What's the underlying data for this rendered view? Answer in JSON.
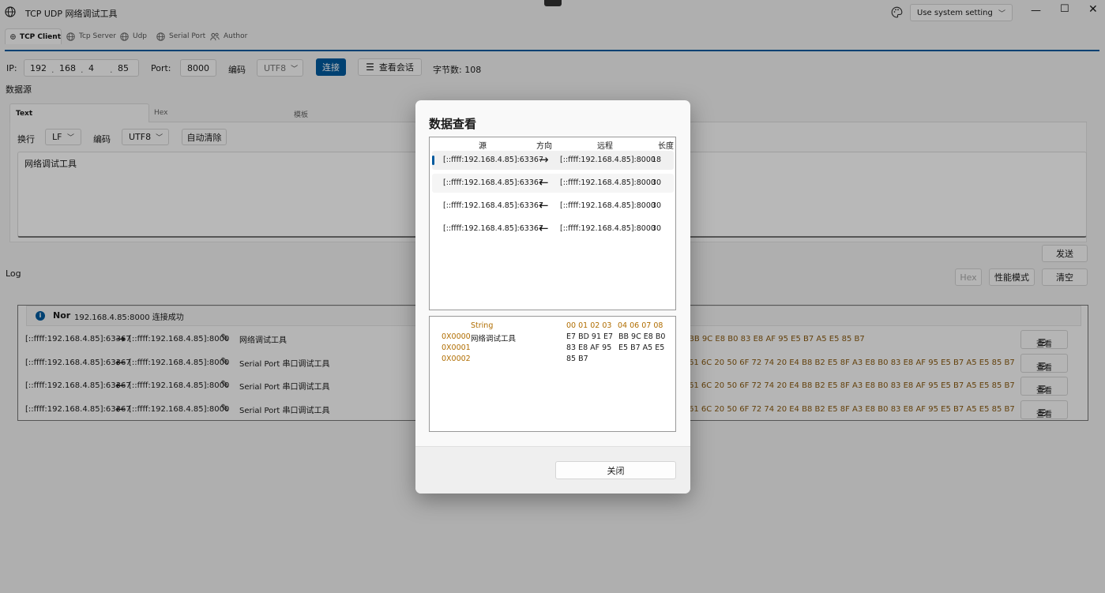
{
  "window": {
    "title": "TCP UDP 网络调试工具",
    "theme_select": "Use system setting"
  },
  "tabs": [
    {
      "label": "TCP Client",
      "active": true
    },
    {
      "label": "Tcp Server"
    },
    {
      "label": "Udp"
    },
    {
      "label": "Serial Port"
    },
    {
      "label": "Author"
    }
  ],
  "connection": {
    "ip_label": "IP:",
    "ip": [
      "192",
      "168",
      "4",
      "85"
    ],
    "ip_sep": ".",
    "port_label": "Port:",
    "port": "8000",
    "encoding_label": "编码",
    "encoding": "UTF8",
    "connect_button": "连接",
    "view_session_button": "查看会话",
    "byte_count": "字节数: 108"
  },
  "datasource": {
    "title": "数据源",
    "tabs": [
      "Text",
      "Hex",
      "模板"
    ],
    "newline_label": "换行",
    "newline": "LF",
    "encoding_label": "编码",
    "encoding": "UTF8",
    "auto_clear_button": "自动清除",
    "text": "网络调试工具",
    "send_button": "发送"
  },
  "log": {
    "title": "Log",
    "hex_button": "Hex",
    "perf_button": "性能模式",
    "clear_button": "清空",
    "notice_level": "Nor",
    "notice_text": "192.168.4.85:8000 连接成功",
    "view_label": "查看",
    "rows": [
      {
        "source": "[::ffff:192.168.4.85]:63367",
        "arrow": "→",
        "remote": "[::ffff:192.168.4.85]:8000",
        "text": "网络调试工具",
        "hex": "BB 9C E8 B0  83 E8 AF 95  E5 B7 A5 E5  85 B7"
      },
      {
        "source": "[::ffff:192.168.4.85]:63367",
        "arrow": "←",
        "remote": "[::ffff:192.168.4.85]:8000",
        "text": "Serial Port 串口调试工具",
        "hex": "61 6C 20 50  6F 72 74 20  E4 B8 B2 E5  8F A3 E8 B0  83 E8 AF 95  E5 B7 A5 E5  85 B7"
      },
      {
        "source": "[::ffff:192.168.4.85]:63367",
        "arrow": "←",
        "remote": "[::ffff:192.168.4.85]:8000",
        "text": "Serial Port 串口调试工具",
        "hex": "61 6C 20 50  6F 72 74 20  E4 B8 B2 E5  8F A3 E8 B0  83 E8 AF 95  E5 B7 A5 E5  85 B7"
      },
      {
        "source": "[::ffff:192.168.4.85]:63367",
        "arrow": "←",
        "remote": "[::ffff:192.168.4.85]:8000",
        "text": "Serial Port 串口调试工具",
        "hex": "61 6C 20 50  6F 72 74 20  E4 B8 B2 E5  8F A3 E8 B0  83 E8 AF 95  E5 B7 A5 E5  85 B7"
      }
    ]
  },
  "dialog": {
    "title": "数据查看",
    "columns": [
      "源",
      "方向",
      "远程",
      "长度"
    ],
    "rows": [
      {
        "source": "[::ffff:192.168.4.85]:63367",
        "arrow": "→",
        "remote": "[::ffff:192.168.4.85]:8000",
        "length": "18",
        "selected": true
      },
      {
        "source": "[::ffff:192.168.4.85]:63367",
        "arrow": "←",
        "remote": "[::ffff:192.168.4.85]:8000",
        "length": "30"
      },
      {
        "source": "[::ffff:192.168.4.85]:63367",
        "arrow": "←",
        "remote": "[::ffff:192.168.4.85]:8000",
        "length": "30"
      },
      {
        "source": "[::ffff:192.168.4.85]:63367",
        "arrow": "←",
        "remote": "[::ffff:192.168.4.85]:8000",
        "length": "30"
      }
    ],
    "hex_view": {
      "string_header": "String",
      "col_header_1": "00 01 02 03",
      "col_header_2": "04 06 07 08",
      "offsets": [
        "0X0000",
        "0X0001",
        "0X0002"
      ],
      "string_value": "网络调试工具",
      "lines": [
        [
          "E7 BD 91 E7",
          "BB 9C E8 B0"
        ],
        [
          "83 E8 AF 95",
          "E5 B7 A5 E5"
        ],
        [
          "85 B7",
          ""
        ]
      ]
    },
    "close_button": "关闭"
  },
  "colors": {
    "accent": "#005a9e",
    "hex_text": "#b06d00"
  }
}
